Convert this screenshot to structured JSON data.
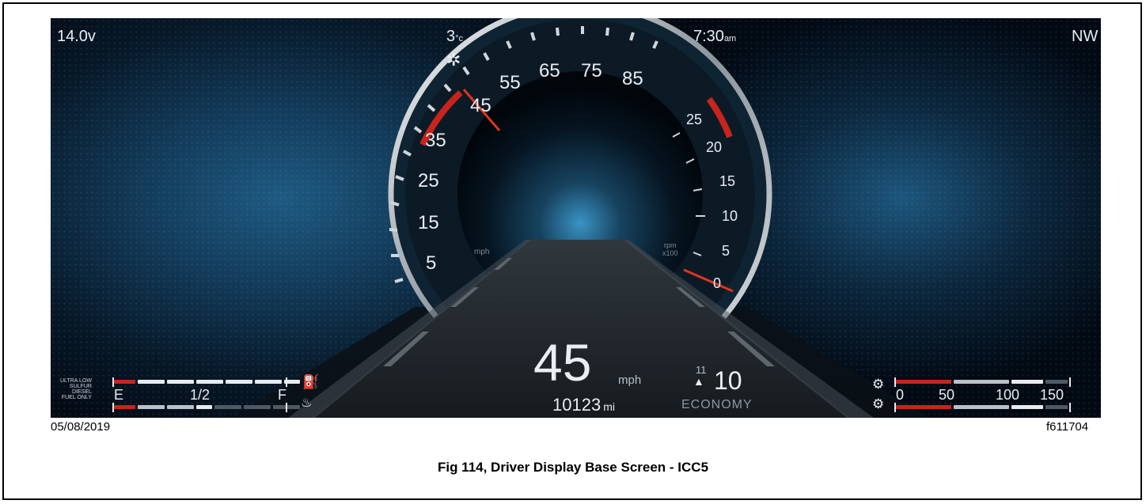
{
  "status_bar": {
    "voltage": "14.0v",
    "temperature": "3",
    "temperature_unit": "°c",
    "time": "7:30",
    "time_suffix": "am",
    "heading": "NW"
  },
  "speedometer": {
    "ticks": [
      "5",
      "15",
      "25",
      "35",
      "45",
      "55",
      "65",
      "75",
      "85"
    ],
    "unit": "mph",
    "needle_value": 45
  },
  "tachometer": {
    "ticks": [
      "0",
      "5",
      "10",
      "15",
      "20",
      "25"
    ],
    "unit_line1": "rpm",
    "unit_line2": "x100",
    "needle_value": 0
  },
  "center": {
    "speed": "45",
    "speed_unit": "mph",
    "odometer": "10123",
    "odometer_unit": "mi",
    "gear_next": "11",
    "gear": "10",
    "mode": "ECONOMY"
  },
  "fuel_gauge": {
    "label_lines": [
      "ULTRA LOW",
      "SULFUR",
      "DIESEL",
      "FUEL ONLY"
    ],
    "empty_label": "E",
    "half_label": "1/2",
    "full_label": "F"
  },
  "air_gauge": {
    "scale": [
      "0",
      "50",
      "100",
      "150"
    ]
  },
  "footer": {
    "date": "05/08/2019",
    "figure_id": "f611704",
    "caption": "Fig 114, Driver Display Base Screen - ICC5"
  },
  "icons": [
    "snowflake-icon",
    "fuel-pump-icon",
    "def-fluid-icon",
    "air-pressure-primary-icon",
    "air-pressure-secondary-icon",
    "gear-up-arrow-icon"
  ]
}
